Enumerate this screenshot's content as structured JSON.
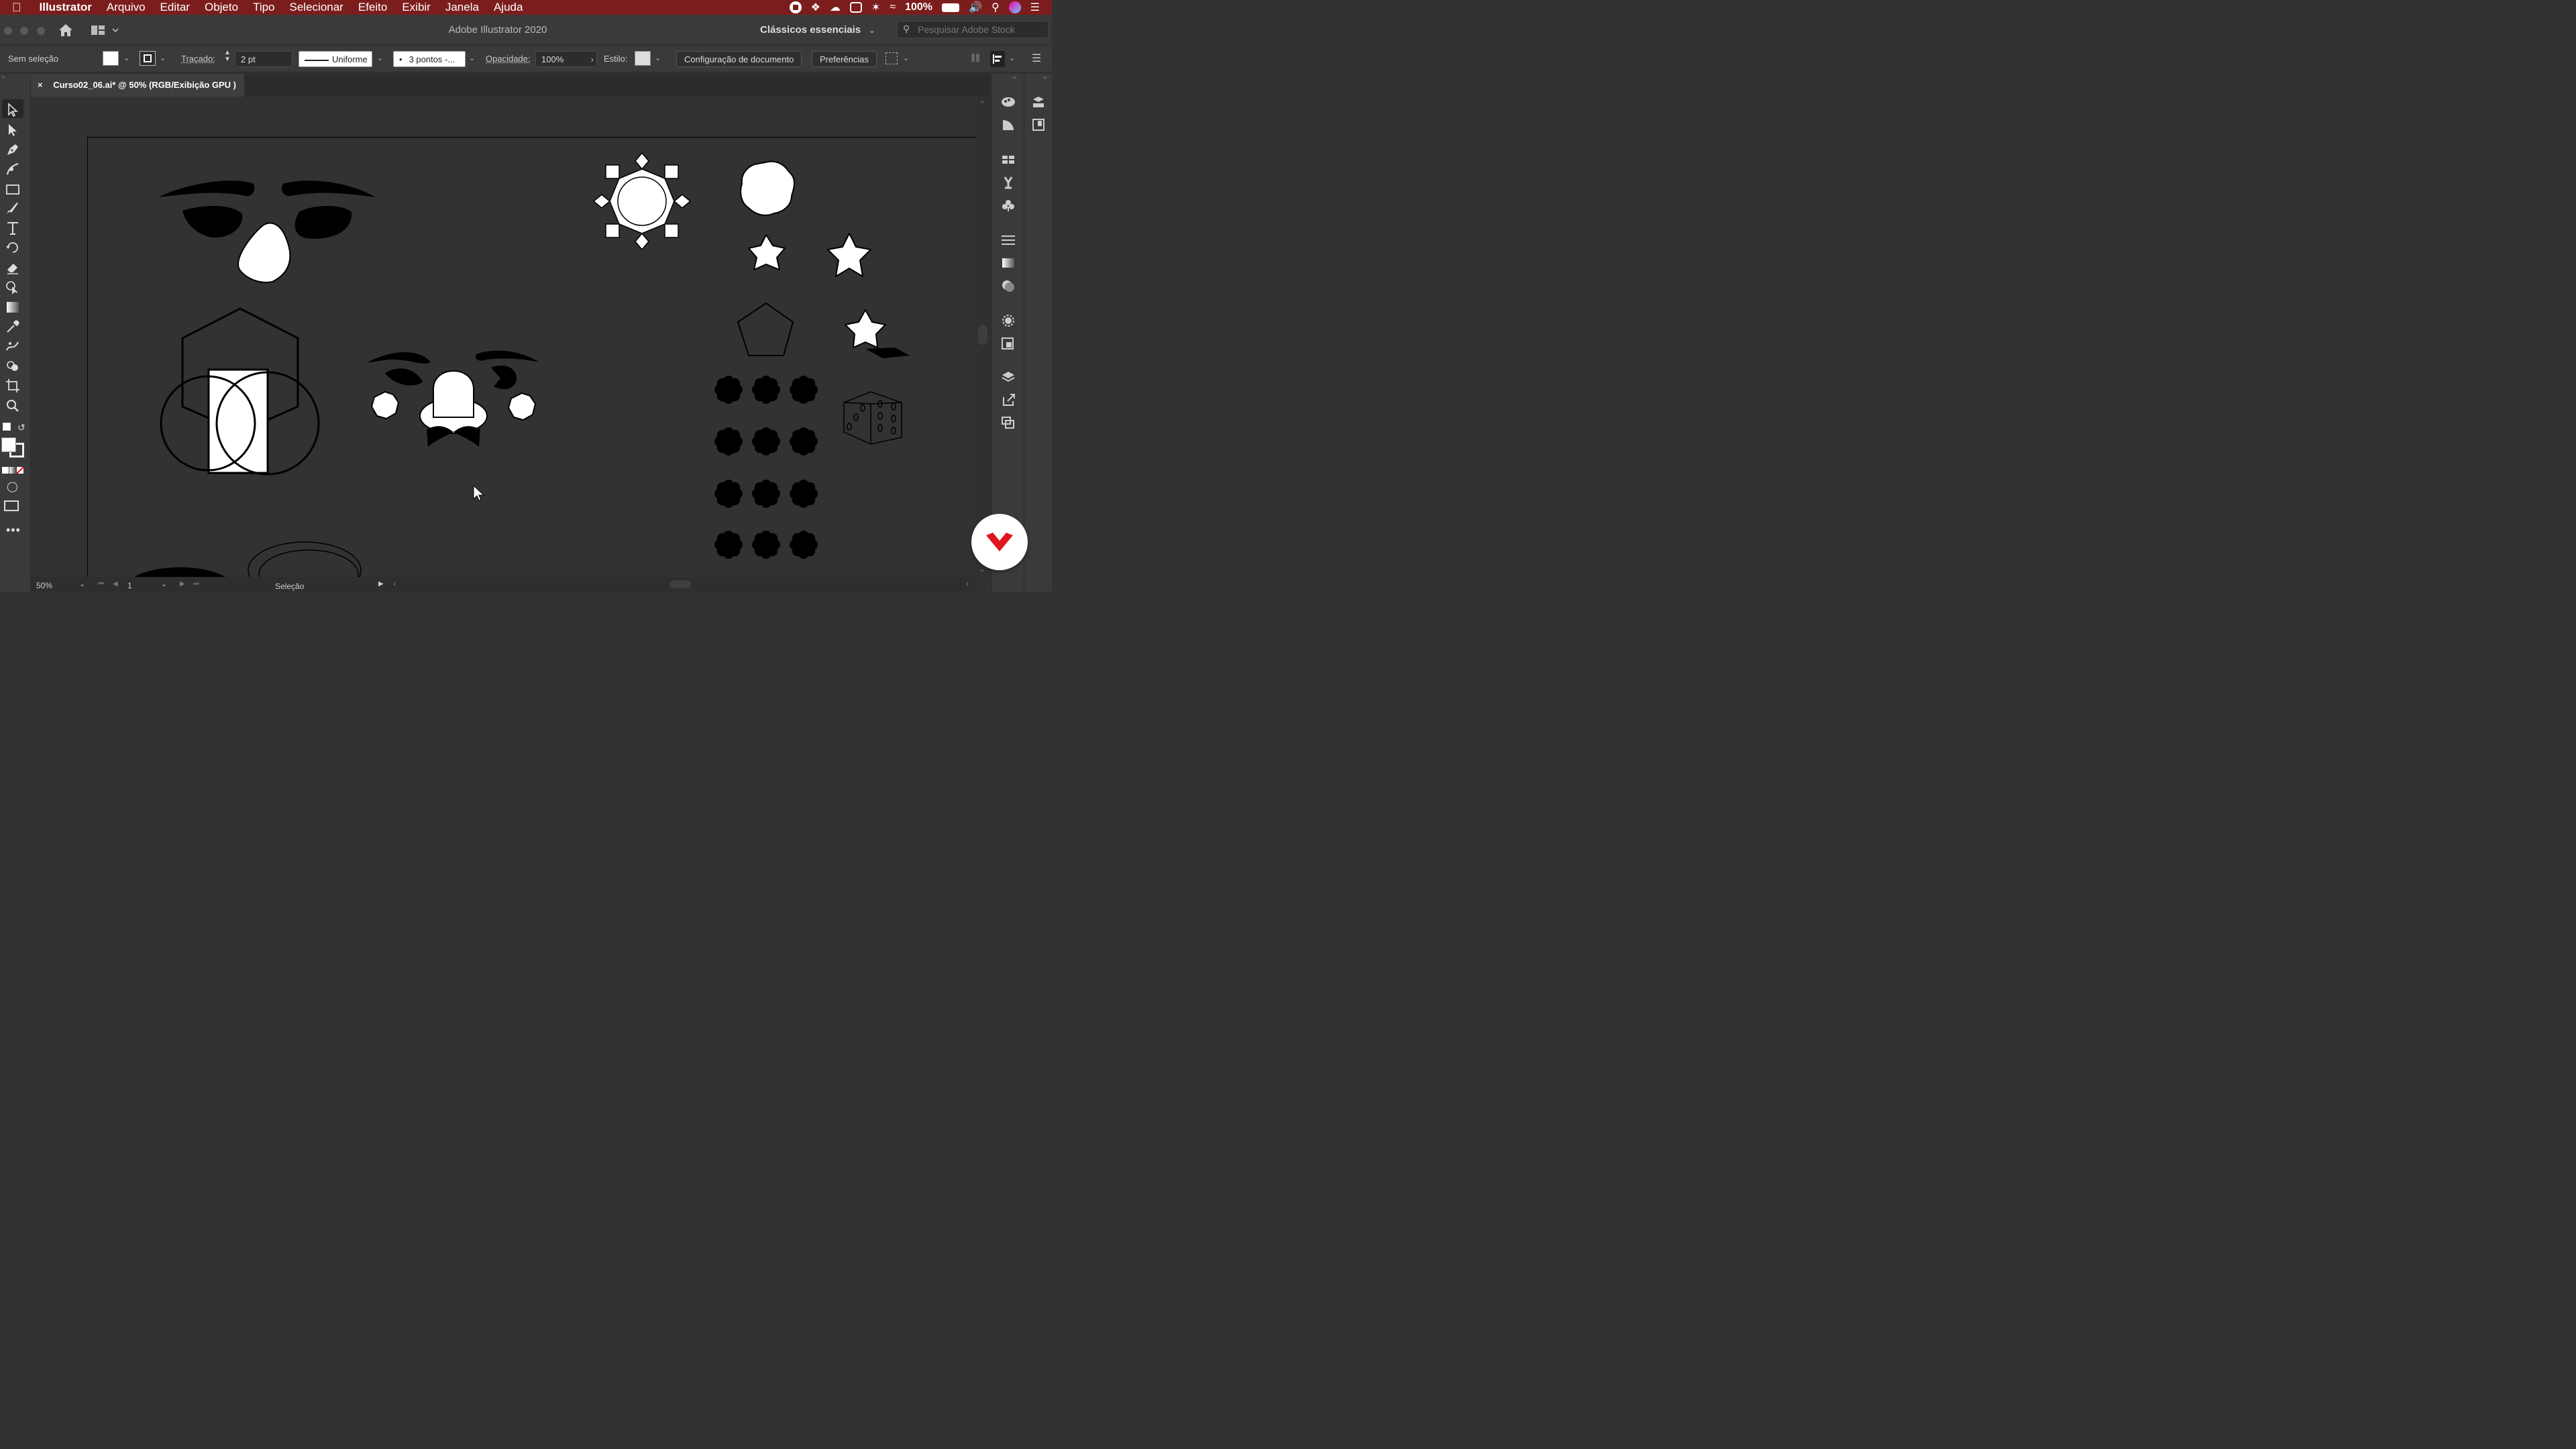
{
  "menubar": {
    "app_name": "Illustrator",
    "items": [
      "Arquivo",
      "Editar",
      "Objeto",
      "Tipo",
      "Selecionar",
      "Efeito",
      "Exibir",
      "Janela",
      "Ajuda"
    ],
    "battery": "100%"
  },
  "appbar": {
    "title": "Adobe Illustrator 2020",
    "workspace": "Clássicos essenciais",
    "stock_placeholder": "Pesquisar Adobe Stock"
  },
  "control": {
    "selection": "Sem seleção",
    "stroke_label": "Traçado:",
    "stroke_weight": "2 pt",
    "profile": "Uniforme",
    "brush": "3 pontos -...",
    "opacity_label": "Opacidade:",
    "opacity": "100%",
    "style_label": "Estilo:",
    "doc_setup": "Configuração de documento",
    "prefs": "Preferências"
  },
  "tab": {
    "close": "×",
    "title": "Curso02_06.ai* @ 50% (RGB/Exibição GPU )"
  },
  "status": {
    "zoom": "50%",
    "artboard": "1",
    "tool": "Seleção"
  },
  "colors": {
    "menubar": "#7c1d1d",
    "panel": "#3a3a3a",
    "canvas": "#323232",
    "brand": "#e0161e"
  },
  "icons": [
    "apple-icon",
    "home-icon",
    "arrange-icon",
    "selection-tool-icon",
    "direct-selection-icon",
    "pen-icon",
    "curvature-icon",
    "rectangle-icon",
    "paintbrush-icon",
    "type-icon",
    "rotate-icon",
    "eraser-icon",
    "puppet-warp-icon",
    "gradient-icon",
    "eyedropper-icon",
    "blend-icon",
    "shape-builder-icon",
    "artboard-icon",
    "zoom-icon",
    "fill-stroke-icon",
    "more-tools-icon",
    "search-icon",
    "wifi-icon",
    "volume-icon"
  ]
}
